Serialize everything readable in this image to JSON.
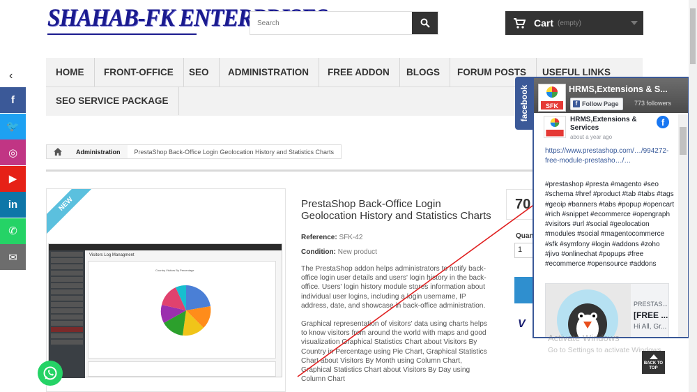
{
  "header": {
    "logo_text": "SHAHAB-FK ENTERPRISES",
    "search_placeholder": "Search",
    "cart_label": "Cart",
    "cart_status": "(empty)"
  },
  "nav": {
    "items": [
      "HOME",
      "FRONT-OFFICE",
      "SEO",
      "ADMINISTRATION",
      "FREE ADDON",
      "BLOGS",
      "FORUM POSTS",
      "USEFUL LINKS",
      "SEO SERVICE PACKAGE"
    ]
  },
  "social": {
    "items": [
      {
        "icon": "facebook-icon",
        "glyph": "f",
        "color": "#3b5998"
      },
      {
        "icon": "twitter-icon",
        "glyph": "🐦",
        "color": "#1da1f2"
      },
      {
        "icon": "instagram-icon",
        "glyph": "◎",
        "color": "#c13584"
      },
      {
        "icon": "youtube-icon",
        "glyph": "▶",
        "color": "#e62117"
      },
      {
        "icon": "linkedin-icon",
        "glyph": "in",
        "color": "#0e76a8"
      },
      {
        "icon": "whatsapp-icon",
        "glyph": "✆",
        "color": "#25d366"
      },
      {
        "icon": "email-icon",
        "glyph": "✉",
        "color": "#6d6d6d"
      }
    ]
  },
  "breadcrumb": {
    "category": "Administration",
    "current": "PrestaShop Back-Office Login Geolocation History and Statistics Charts"
  },
  "product": {
    "badge": "NEW",
    "title": "PrestaShop Back-Office Login Geolocation History and Statistics Charts",
    "reference_label": "Reference:",
    "reference": "SFK-42",
    "condition_label": "Condition:",
    "condition": "New product",
    "description_1": "The PrestaShop addon helps administrators to notify back-office login user details and users' login history in the back-office. Users' login history module stores information about individual user logins, including a login username, IP address, date, and showcase in back-office administration.",
    "description_2": "Graphical representation of visitors' data using charts helps to know visitors from around the world with maps and good visualization Graphical Statistics Chart about Visitors By Country in Percentage using Pie Chart, Graphical Statistics Chart about Visitors By Month using Column Chart, Graphical Statistics Chart about Visitors By Day using Column Chart",
    "price_partial": "70",
    "quantity_label": "Quan",
    "quantity": "1",
    "screenshot_title": "Visitors Log Managment",
    "screenshot_chart_title": "Country Visitors By Percentage"
  },
  "facebook": {
    "tab_label": "facebook",
    "page_name": "HRMS,Extensions & S...",
    "follow_label": "Follow Page",
    "followers": "773 followers",
    "post_author": "HRMS,Extensions & Services",
    "post_time": "about a year ago",
    "post_link": "https://www.prestashop.com/…/994272-free-module-prestasho…/…",
    "post_tags": "#prestashop #presta #magento #seo #schema #href #product #tab #tabs #tags #geoip #banners #tabs #popup #opencart #rich #snippet #ecommerce #opengraph #visitors #url #social #geolocation #modules #social #magentocommerce #sfk #symfony #login #addons #zoho #jivo #onlinechat #popups #free #ecommerce #opensource #addons",
    "card_site": "PRESTAS...",
    "card_title": "[FREE ...",
    "card_subtitle": "Hi All, Gr..."
  },
  "overlay": {
    "activate_title": "Activate Windows",
    "activate_sub": "Go to Settings to activate Windows.",
    "back_to_top": "BACK TO TOP"
  }
}
